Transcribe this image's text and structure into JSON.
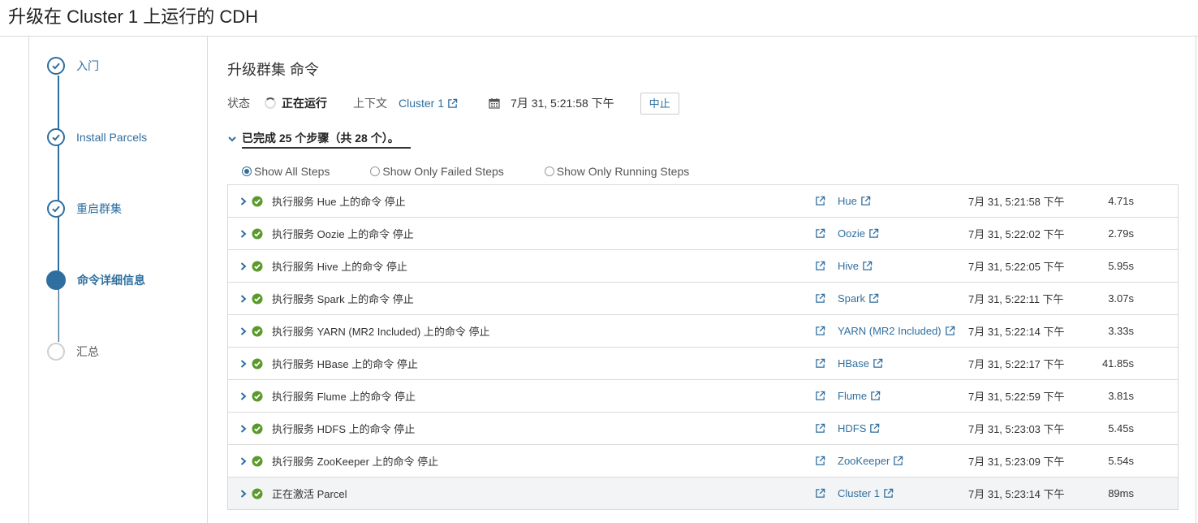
{
  "page": {
    "title": "升级在 Cluster 1 上运行的 CDH"
  },
  "wizard": {
    "steps": [
      {
        "label": "入门",
        "state": "done"
      },
      {
        "label": "Install Parcels",
        "state": "done"
      },
      {
        "label": "重启群集",
        "state": "done"
      },
      {
        "label": "命令详细信息",
        "state": "current"
      },
      {
        "label": "汇总",
        "state": "pending"
      }
    ]
  },
  "command": {
    "title": "升级群集 命令",
    "status_label": "状态",
    "status_value": "正在运行",
    "context_label": "上下文",
    "context_link": "Cluster 1",
    "timestamp": "7月 31, 5:21:58 下午",
    "abort_label": "中止",
    "summary": "已完成 25 个步骤（共 28 个）。"
  },
  "filters": {
    "options": [
      "Show All Steps",
      "Show Only Failed Steps",
      "Show Only Running Steps"
    ],
    "selected": "Show All Steps"
  },
  "colors": {
    "accent": "#2f6f9f",
    "success": "#5a9a2a"
  },
  "rows": [
    {
      "desc": "执行服务 Hue 上的命令 停止",
      "service": "Hue",
      "time": "7月 31, 5:21:58 下午",
      "duration": "4.71s"
    },
    {
      "desc": "执行服务 Oozie 上的命令 停止",
      "service": "Oozie",
      "time": "7月 31, 5:22:02 下午",
      "duration": "2.79s"
    },
    {
      "desc": "执行服务 Hive 上的命令 停止",
      "service": "Hive",
      "time": "7月 31, 5:22:05 下午",
      "duration": "5.95s"
    },
    {
      "desc": "执行服务 Spark 上的命令 停止",
      "service": "Spark",
      "time": "7月 31, 5:22:11 下午",
      "duration": "3.07s"
    },
    {
      "desc": "执行服务 YARN (MR2 Included) 上的命令 停止",
      "service": "YARN (MR2 Included)",
      "time": "7月 31, 5:22:14 下午",
      "duration": "3.33s"
    },
    {
      "desc": "执行服务 HBase 上的命令 停止",
      "service": "HBase",
      "time": "7月 31, 5:22:17 下午",
      "duration": "41.85s"
    },
    {
      "desc": "执行服务 Flume 上的命令 停止",
      "service": "Flume",
      "time": "7月 31, 5:22:59 下午",
      "duration": "3.81s"
    },
    {
      "desc": "执行服务 HDFS 上的命令 停止",
      "service": "HDFS",
      "time": "7月 31, 5:23:03 下午",
      "duration": "5.45s"
    },
    {
      "desc": "执行服务 ZooKeeper 上的命令 停止",
      "service": "ZooKeeper",
      "time": "7月 31, 5:23:09 下午",
      "duration": "5.54s"
    },
    {
      "desc": "正在激活 Parcel",
      "service": "Cluster 1",
      "time": "7月 31, 5:23:14 下午",
      "duration": "89ms"
    }
  ]
}
